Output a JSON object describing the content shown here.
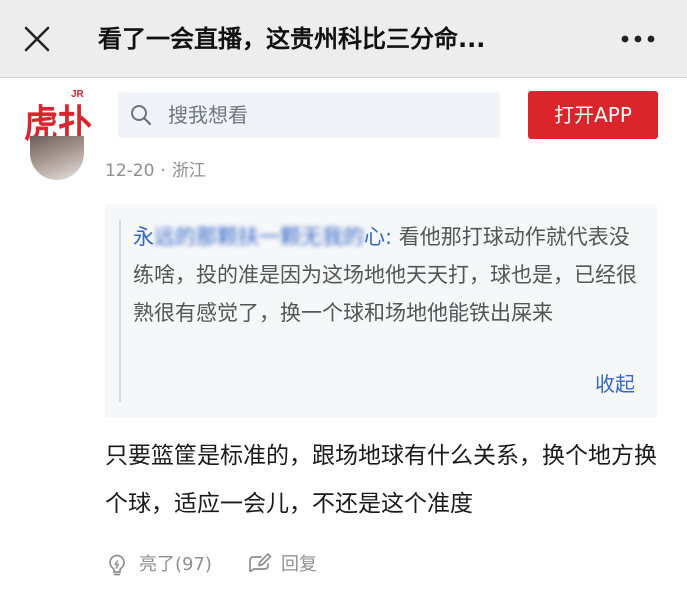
{
  "window": {
    "title": "看了一会直播，这贵州科比三分命...",
    "close_icon": "close-icon",
    "more_icon": "more-dots-icon"
  },
  "appbar": {
    "logo_text": "虎扑",
    "logo_badge": "JR",
    "brand_color": "#d9252b",
    "search_placeholder": "搜我想看",
    "search_icon": "search-icon",
    "open_app_label": "打开APP"
  },
  "comment": {
    "date": "12-20",
    "separator": "·",
    "location": "浙江",
    "quote": {
      "author_visible": "永",
      "author_blurred": "远的那颗扶一颗无我的",
      "author_tail": "心:",
      "text": "看他那打球动作就代表没练啥，投的准是因为这场地他天天打，球也是，已经很熟很有感觉了，换一个球和场地他能铁出屎来",
      "collapse_label": "收起"
    },
    "body": "只要篮筐是标准的，跟场地球有什么关系，换个地方换个球，适应一会儿，不还是这个准度",
    "actions": {
      "like_label": "亮了(97)",
      "like_icon": "lightbulb-icon",
      "reply_label": "回复",
      "reply_icon": "edit-reply-icon"
    }
  }
}
